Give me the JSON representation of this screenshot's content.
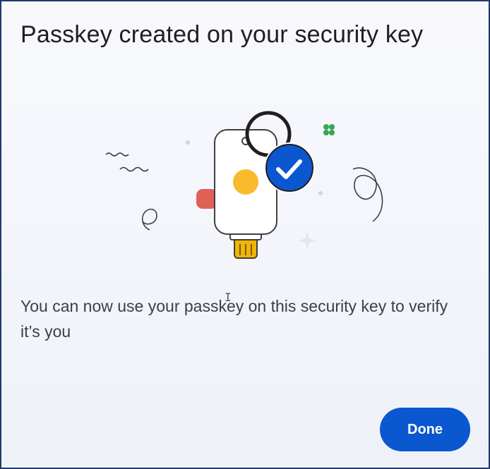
{
  "dialog": {
    "title": "Passkey created on your security key",
    "message": "You can now use your passkey on this security key to verify it’s you",
    "done_label": "Done"
  },
  "icons": {
    "illustration": "security-key-illustration",
    "check": "check-badge-icon",
    "sparkle": "sparkle-icon",
    "clover": "clover-icon"
  },
  "colors": {
    "primary": "#0b57d0",
    "title_text": "#1f1f1f",
    "body_text": "#3c4043",
    "key_dot": "#f9bb2c",
    "key_connector": "#f4b400",
    "key_cap": "#e06055",
    "clover": "#34a853",
    "border": "#1f3a68"
  }
}
